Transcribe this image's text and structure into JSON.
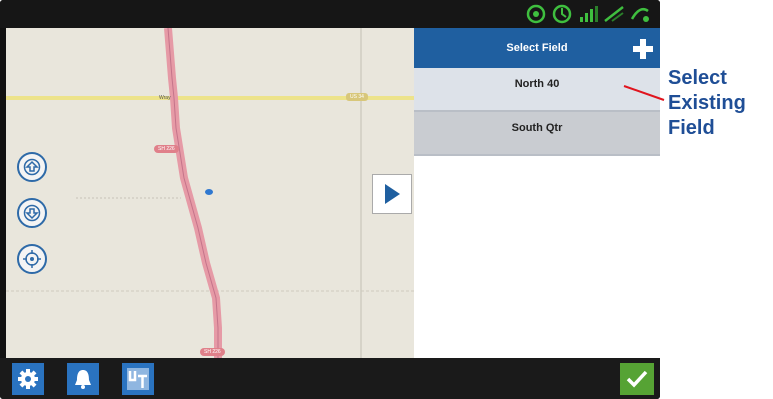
{
  "panel": {
    "title": "Select Field",
    "fields": [
      {
        "label": "North 40"
      },
      {
        "label": "South Qtr"
      }
    ]
  },
  "map": {
    "road_labels": [
      "SH 226",
      "SH 226"
    ],
    "highway_label": "US 34",
    "town_label": "Wray"
  },
  "callout": {
    "line1": "Select",
    "line2": "Existing",
    "line3": "Field"
  },
  "colors": {
    "accent": "#1f5fa0",
    "confirm": "#56a334",
    "callout_text": "#1f4e96",
    "callout_line": "#e0141e"
  },
  "icons": {
    "settings": "gear-icon",
    "alerts": "bell-icon",
    "implement": "ut-icon",
    "confirm": "checkmark-icon",
    "add": "plus-icon"
  }
}
